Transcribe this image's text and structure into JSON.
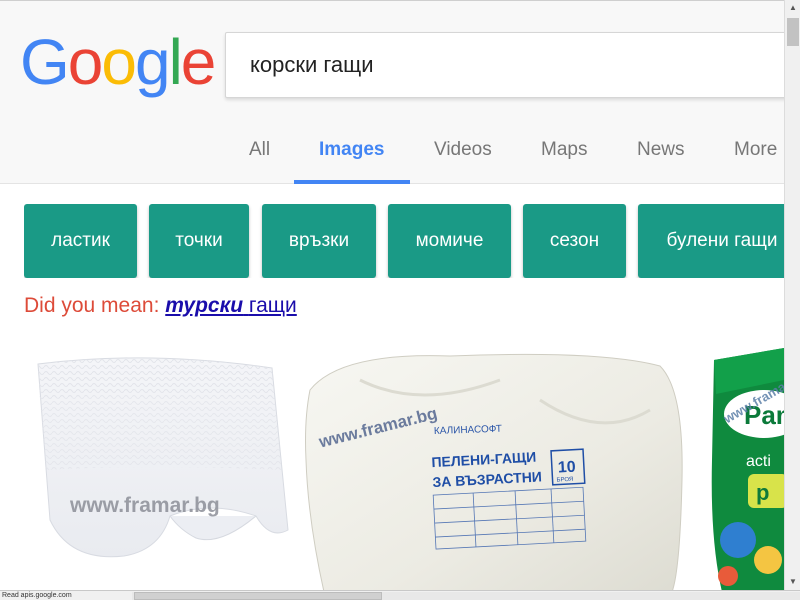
{
  "logo": {
    "letters": [
      {
        "ch": "G",
        "color": "#4285f4"
      },
      {
        "ch": "o",
        "color": "#ea4335"
      },
      {
        "ch": "o",
        "color": "#fbbc05"
      },
      {
        "ch": "g",
        "color": "#4285f4"
      },
      {
        "ch": "l",
        "color": "#34a853"
      },
      {
        "ch": "e",
        "color": "#ea4335"
      }
    ]
  },
  "search": {
    "value": "корски гащи"
  },
  "tabs": [
    {
      "label": "All"
    },
    {
      "label": "Images",
      "active": true
    },
    {
      "label": "Videos"
    },
    {
      "label": "Maps"
    },
    {
      "label": "News"
    },
    {
      "label": "More"
    }
  ],
  "chips": [
    "ластик",
    "точки",
    "връзки",
    "момиче",
    "сезон",
    "булени гащи"
  ],
  "did_you_mean": {
    "label": "Did you mean:",
    "suggestion_bold": "турски",
    "suggestion_rest": "гащи"
  },
  "images": [
    {
      "watermark": "www.framar.bg"
    },
    {
      "watermark": "www.framar.bg",
      "brand": "КАЛИНАСОФТ",
      "product_line1": "ПЕЛЕНИ-ГАЩИ",
      "product_line2": "ЗА ВЪЗРАСТНИ",
      "count": "10",
      "count_unit": "БРОЯ"
    },
    {
      "watermark": "www.framar.bg",
      "brand": "Pam",
      "sub": "acti"
    }
  ],
  "status_bar": {
    "text": "Read apis.google.com"
  },
  "colors": {
    "accent": "#4285f4",
    "chip": "#1a9a86",
    "dym_label": "#dd4b39",
    "link": "#1a0dab"
  }
}
